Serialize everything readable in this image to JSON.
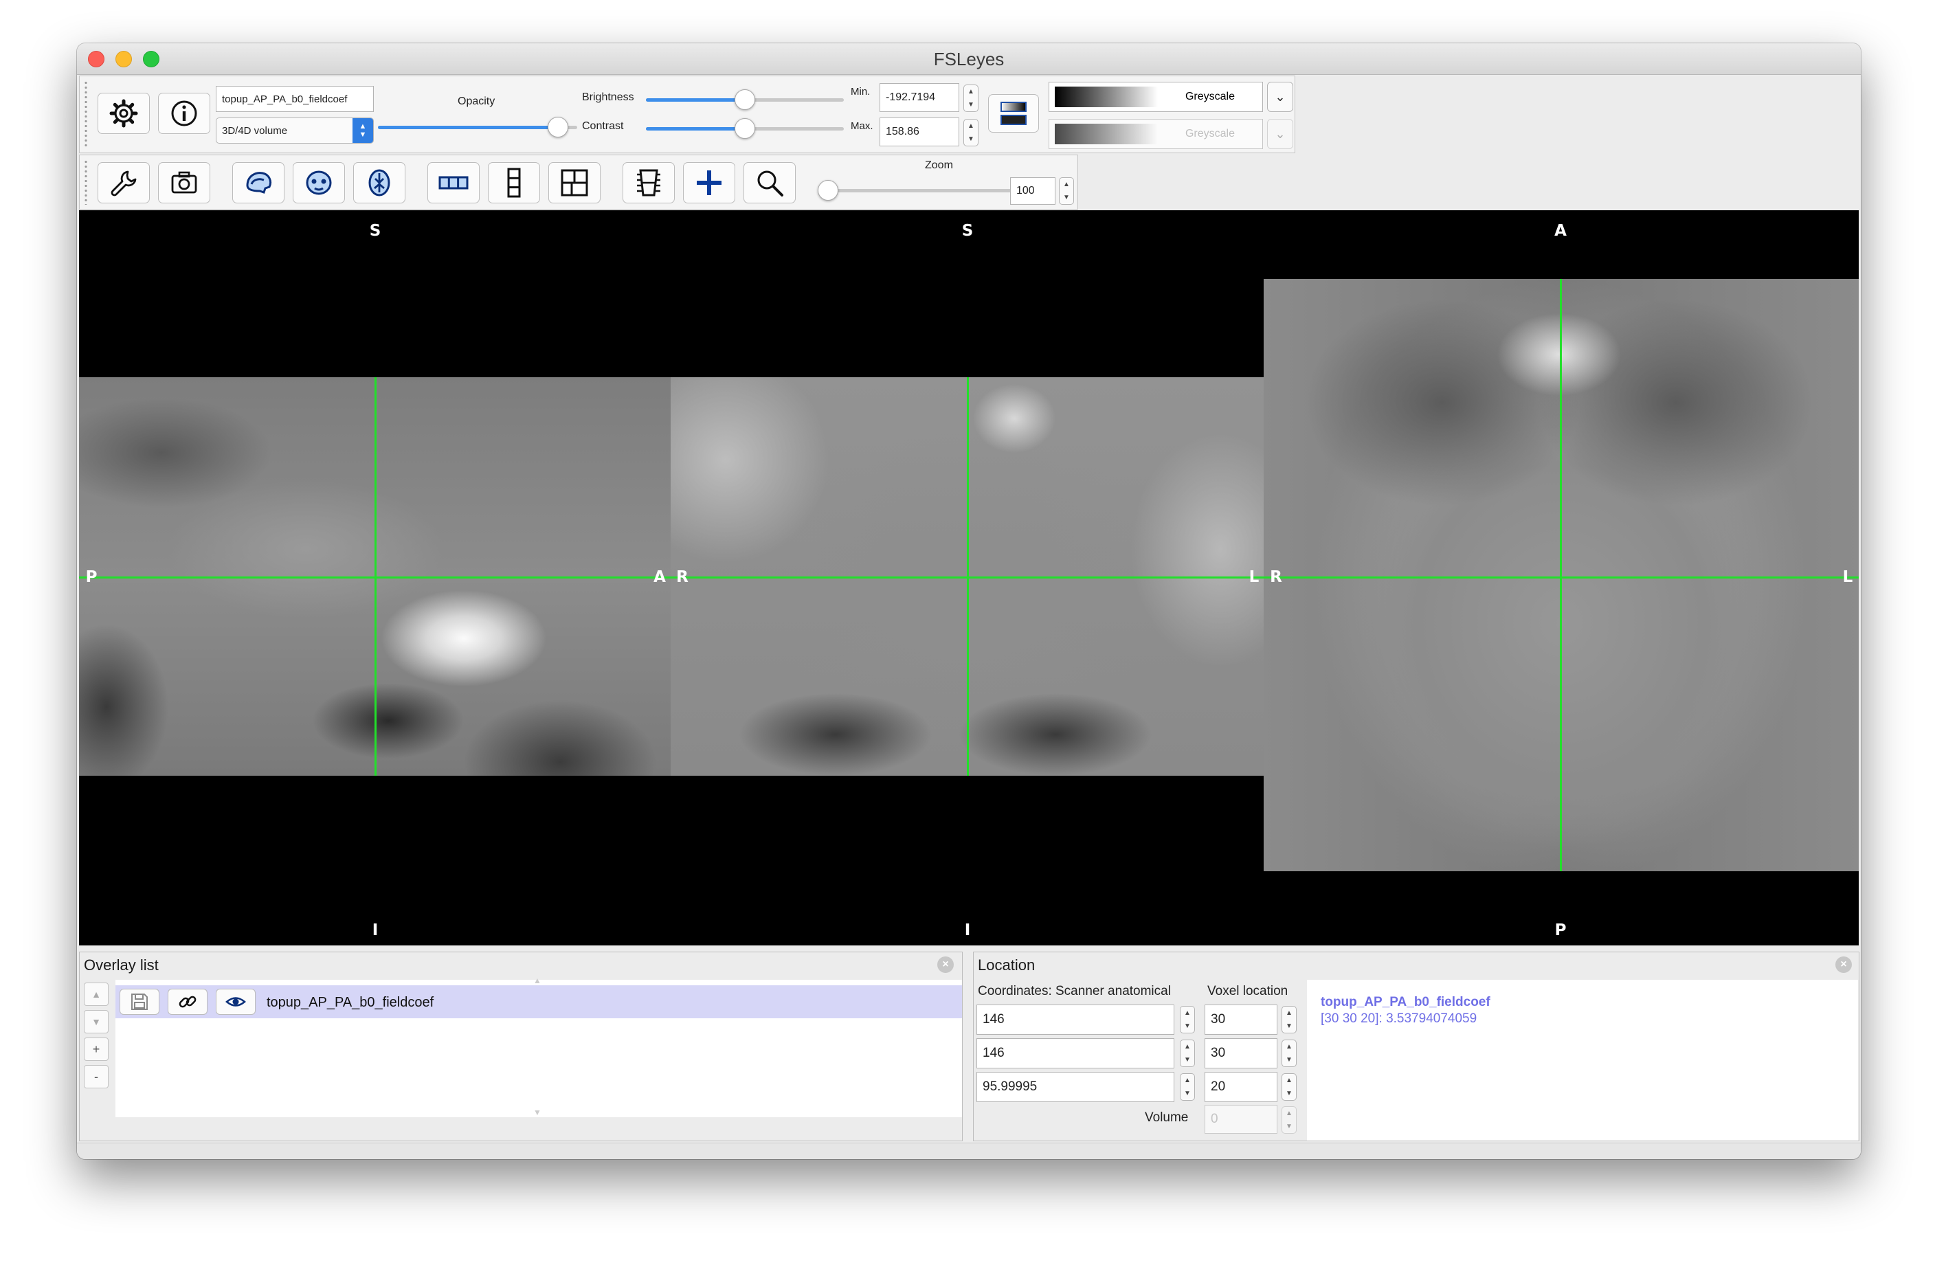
{
  "window": {
    "title": "FSLeyes"
  },
  "overlay_toolbar": {
    "overlay_name": "topup_AP_PA_b0_fieldcoef",
    "overlay_type": "3D/4D volume",
    "opacity_label": "Opacity",
    "opacity": 0.95,
    "brightness_label": "Brightness",
    "brightness": 0.5,
    "contrast_label": "Contrast",
    "contrast": 0.5,
    "min_label": "Min.",
    "min_value": "-192.7194",
    "max_label": "Max.",
    "max_value": "158.86",
    "colormap": "Greyscale",
    "neg_colormap": "Greyscale"
  },
  "ortho_toolbar": {
    "zoom_label": "Zoom",
    "zoom_value": "100",
    "zoom": 0.0
  },
  "views": {
    "sagittal": {
      "top": "S",
      "bottom": "I",
      "left": "P",
      "right": "A"
    },
    "coronal": {
      "top": "S",
      "bottom": "I",
      "left": "R",
      "right": "L"
    },
    "axial": {
      "top": "A",
      "bottom": "P",
      "left": "R",
      "right": "L"
    }
  },
  "cursor_color": "#22e02a",
  "overlay_list": {
    "title": "Overlay list",
    "items": [
      {
        "name": "topup_AP_PA_b0_fieldcoef",
        "selected": true
      }
    ],
    "up": "▲",
    "down": "▼",
    "add": "+",
    "remove": "-"
  },
  "location_panel": {
    "title": "Location",
    "coord_label": "Coordinates: Scanner anatomical",
    "voxel_label": "Voxel location",
    "coords": [
      "146",
      "146",
      "95.99995"
    ],
    "voxels": [
      "30",
      "30",
      "20"
    ],
    "volume_label": "Volume",
    "volume_value": "0",
    "info_name": "topup_AP_PA_b0_fieldcoef",
    "info_value": "[30 30 20]: 3.53794074059",
    "info_color": "#6f6fe6"
  },
  "icons": [
    "gear-icon",
    "info-icon",
    "wrench-icon",
    "camera-icon",
    "sagittal-icon",
    "coronal-icon",
    "axial-icon",
    "horizontal-layout-icon",
    "vertical-layout-icon",
    "grid-layout-icon",
    "movie-icon",
    "crosshair-icon",
    "zoom-icon",
    "save-icon",
    "link-icon",
    "eye-icon"
  ]
}
